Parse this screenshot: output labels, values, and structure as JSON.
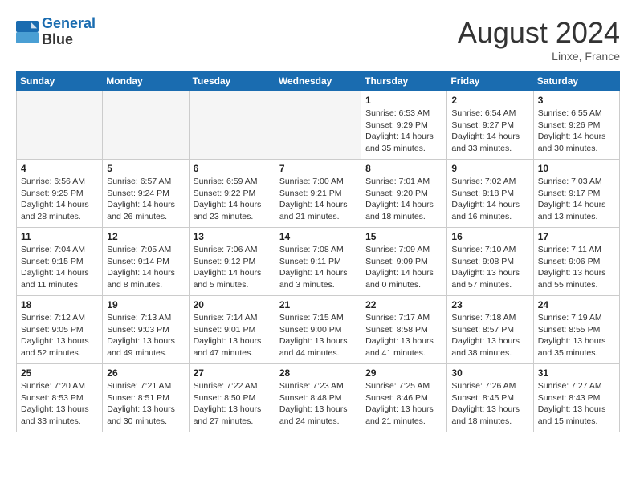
{
  "header": {
    "logo_line1": "General",
    "logo_line2": "Blue",
    "month": "August 2024",
    "location": "Linxe, France"
  },
  "weekdays": [
    "Sunday",
    "Monday",
    "Tuesday",
    "Wednesday",
    "Thursday",
    "Friday",
    "Saturday"
  ],
  "weeks": [
    [
      {
        "day": "",
        "info": ""
      },
      {
        "day": "",
        "info": ""
      },
      {
        "day": "",
        "info": ""
      },
      {
        "day": "",
        "info": ""
      },
      {
        "day": "1",
        "info": "Sunrise: 6:53 AM\nSunset: 9:29 PM\nDaylight: 14 hours\nand 35 minutes."
      },
      {
        "day": "2",
        "info": "Sunrise: 6:54 AM\nSunset: 9:27 PM\nDaylight: 14 hours\nand 33 minutes."
      },
      {
        "day": "3",
        "info": "Sunrise: 6:55 AM\nSunset: 9:26 PM\nDaylight: 14 hours\nand 30 minutes."
      }
    ],
    [
      {
        "day": "4",
        "info": "Sunrise: 6:56 AM\nSunset: 9:25 PM\nDaylight: 14 hours\nand 28 minutes."
      },
      {
        "day": "5",
        "info": "Sunrise: 6:57 AM\nSunset: 9:24 PM\nDaylight: 14 hours\nand 26 minutes."
      },
      {
        "day": "6",
        "info": "Sunrise: 6:59 AM\nSunset: 9:22 PM\nDaylight: 14 hours\nand 23 minutes."
      },
      {
        "day": "7",
        "info": "Sunrise: 7:00 AM\nSunset: 9:21 PM\nDaylight: 14 hours\nand 21 minutes."
      },
      {
        "day": "8",
        "info": "Sunrise: 7:01 AM\nSunset: 9:20 PM\nDaylight: 14 hours\nand 18 minutes."
      },
      {
        "day": "9",
        "info": "Sunrise: 7:02 AM\nSunset: 9:18 PM\nDaylight: 14 hours\nand 16 minutes."
      },
      {
        "day": "10",
        "info": "Sunrise: 7:03 AM\nSunset: 9:17 PM\nDaylight: 14 hours\nand 13 minutes."
      }
    ],
    [
      {
        "day": "11",
        "info": "Sunrise: 7:04 AM\nSunset: 9:15 PM\nDaylight: 14 hours\nand 11 minutes."
      },
      {
        "day": "12",
        "info": "Sunrise: 7:05 AM\nSunset: 9:14 PM\nDaylight: 14 hours\nand 8 minutes."
      },
      {
        "day": "13",
        "info": "Sunrise: 7:06 AM\nSunset: 9:12 PM\nDaylight: 14 hours\nand 5 minutes."
      },
      {
        "day": "14",
        "info": "Sunrise: 7:08 AM\nSunset: 9:11 PM\nDaylight: 14 hours\nand 3 minutes."
      },
      {
        "day": "15",
        "info": "Sunrise: 7:09 AM\nSunset: 9:09 PM\nDaylight: 14 hours\nand 0 minutes."
      },
      {
        "day": "16",
        "info": "Sunrise: 7:10 AM\nSunset: 9:08 PM\nDaylight: 13 hours\nand 57 minutes."
      },
      {
        "day": "17",
        "info": "Sunrise: 7:11 AM\nSunset: 9:06 PM\nDaylight: 13 hours\nand 55 minutes."
      }
    ],
    [
      {
        "day": "18",
        "info": "Sunrise: 7:12 AM\nSunset: 9:05 PM\nDaylight: 13 hours\nand 52 minutes."
      },
      {
        "day": "19",
        "info": "Sunrise: 7:13 AM\nSunset: 9:03 PM\nDaylight: 13 hours\nand 49 minutes."
      },
      {
        "day": "20",
        "info": "Sunrise: 7:14 AM\nSunset: 9:01 PM\nDaylight: 13 hours\nand 47 minutes."
      },
      {
        "day": "21",
        "info": "Sunrise: 7:15 AM\nSunset: 9:00 PM\nDaylight: 13 hours\nand 44 minutes."
      },
      {
        "day": "22",
        "info": "Sunrise: 7:17 AM\nSunset: 8:58 PM\nDaylight: 13 hours\nand 41 minutes."
      },
      {
        "day": "23",
        "info": "Sunrise: 7:18 AM\nSunset: 8:57 PM\nDaylight: 13 hours\nand 38 minutes."
      },
      {
        "day": "24",
        "info": "Sunrise: 7:19 AM\nSunset: 8:55 PM\nDaylight: 13 hours\nand 35 minutes."
      }
    ],
    [
      {
        "day": "25",
        "info": "Sunrise: 7:20 AM\nSunset: 8:53 PM\nDaylight: 13 hours\nand 33 minutes."
      },
      {
        "day": "26",
        "info": "Sunrise: 7:21 AM\nSunset: 8:51 PM\nDaylight: 13 hours\nand 30 minutes."
      },
      {
        "day": "27",
        "info": "Sunrise: 7:22 AM\nSunset: 8:50 PM\nDaylight: 13 hours\nand 27 minutes."
      },
      {
        "day": "28",
        "info": "Sunrise: 7:23 AM\nSunset: 8:48 PM\nDaylight: 13 hours\nand 24 minutes."
      },
      {
        "day": "29",
        "info": "Sunrise: 7:25 AM\nSunset: 8:46 PM\nDaylight: 13 hours\nand 21 minutes."
      },
      {
        "day": "30",
        "info": "Sunrise: 7:26 AM\nSunset: 8:45 PM\nDaylight: 13 hours\nand 18 minutes."
      },
      {
        "day": "31",
        "info": "Sunrise: 7:27 AM\nSunset: 8:43 PM\nDaylight: 13 hours\nand 15 minutes."
      }
    ]
  ]
}
